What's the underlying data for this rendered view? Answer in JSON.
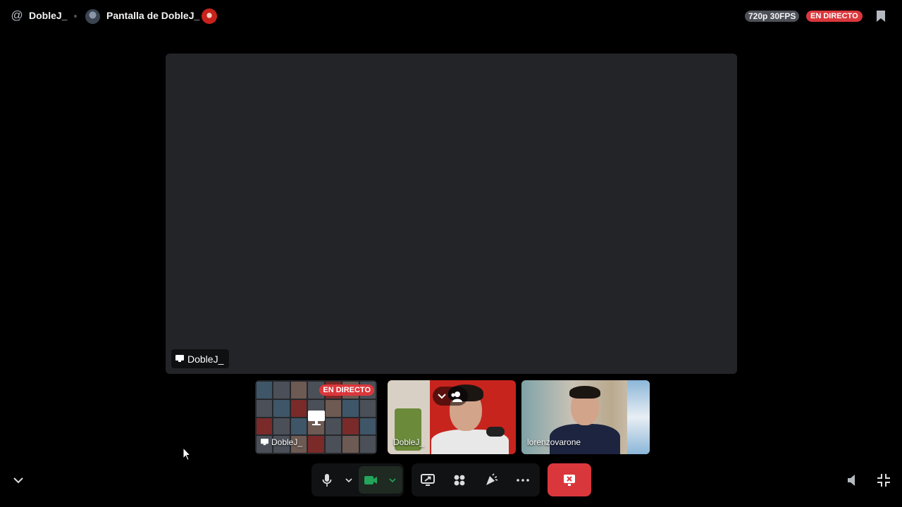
{
  "header": {
    "user_name": "DobleJ_",
    "stream_title": "Pantalla de DobleJ_",
    "quality": "720p 30FPS",
    "live_label": "EN DIRECTO"
  },
  "stage": {
    "label": "DobleJ_"
  },
  "tiles": [
    {
      "name": "DobleJ_",
      "live_label": "EN DIRECTO",
      "kind": "screen-share"
    },
    {
      "name": "DobleJ_",
      "kind": "camera"
    },
    {
      "name": "lorenzovarone",
      "kind": "camera"
    }
  ],
  "controls": {
    "mic": "microphone-icon",
    "camera": "camera-icon",
    "share": "screen-share-icon",
    "activities": "activities-icon",
    "soundboard": "soundboard-icon",
    "more": "more-icon",
    "disconnect": "disconnect-icon"
  },
  "colors": {
    "accent_live": "#da373c",
    "camera_on": "#23a55a",
    "stage_bg": "#232428",
    "page_bg": "#000000"
  }
}
